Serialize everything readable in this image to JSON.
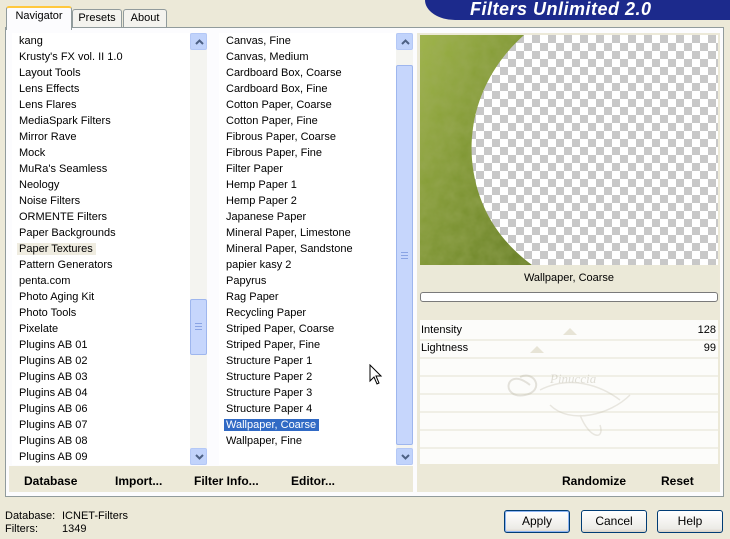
{
  "app_title": "Filters Unlimited 2.0",
  "tabs": [
    "Navigator",
    "Presets",
    "About"
  ],
  "categories": [
    "kang",
    "Krusty's FX vol. II 1.0",
    "Layout Tools",
    "Lens Effects",
    "Lens Flares",
    "MediaSpark Filters",
    "Mirror Rave",
    "Mock",
    "MuRa's Seamless",
    "Neology",
    "Noise Filters",
    "ORMENTE Filters",
    "Paper Backgrounds",
    "Paper Textures",
    "Pattern Generators",
    "penta.com",
    "Photo Aging Kit",
    "Photo Tools",
    "Pixelate",
    "Plugins AB 01",
    "Plugins AB 02",
    "Plugins AB 03",
    "Plugins AB 04",
    "Plugins AB 06",
    "Plugins AB 07",
    "Plugins AB 08",
    "Plugins AB 09"
  ],
  "selected_category": "Paper Textures",
  "filters": [
    "Canvas, Fine",
    "Canvas, Medium",
    "Cardboard Box, Coarse",
    "Cardboard Box, Fine",
    "Cotton Paper, Coarse",
    "Cotton Paper, Fine",
    "Fibrous Paper, Coarse",
    "Fibrous Paper, Fine",
    "Filter Paper",
    "Hemp Paper 1",
    "Hemp Paper 2",
    "Japanese Paper",
    "Mineral Paper, Limestone",
    "Mineral Paper, Sandstone",
    "papier kasy 2",
    "Papyrus",
    "Rag Paper",
    "Recycling Paper",
    "Striped Paper, Coarse",
    "Striped Paper, Fine",
    "Structure Paper 1",
    "Structure Paper 2",
    "Structure Paper 3",
    "Structure Paper 4",
    "Wallpaper, Coarse",
    "Wallpaper, Fine"
  ],
  "selected_filter": "Wallpaper, Coarse",
  "preview_filter_name": "Wallpaper, Coarse",
  "params": [
    {
      "label": "Intensity",
      "value": "128",
      "level": 0.502
    },
    {
      "label": "Lightness",
      "value": "99",
      "level": 0.388
    }
  ],
  "bottom_links": {
    "database": "Database",
    "import": "Import...",
    "filter_info": "Filter Info...",
    "editor": "Editor...",
    "randomize": "Randomize",
    "reset": "Reset"
  },
  "status": {
    "database_label": "Database:",
    "database_value": "ICNET-Filters",
    "filters_label": "Filters:",
    "filters_value": "1349"
  },
  "buttons": {
    "apply": "Apply",
    "cancel": "Cancel",
    "help": "Help"
  },
  "colors": {
    "banner": "#1c2a8c",
    "selection": "#316ac5",
    "preview_texture": "#8aa033"
  }
}
